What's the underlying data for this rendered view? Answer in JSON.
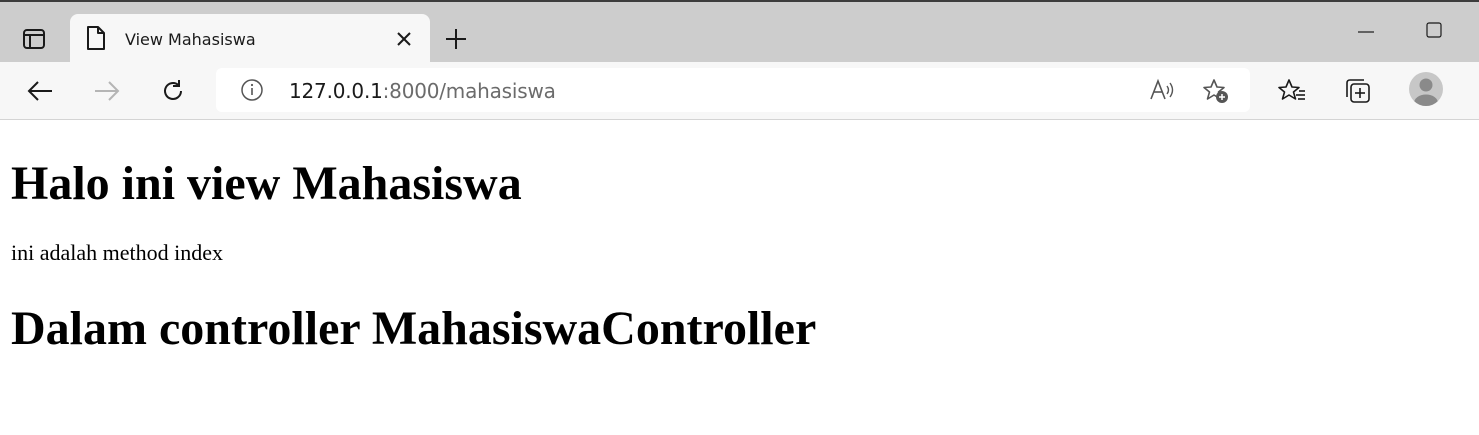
{
  "browser": {
    "tab": {
      "title": "View Mahasiswa"
    },
    "address": {
      "host": "127.0.0.1",
      "rest": ":8000/mahasiswa"
    },
    "icons": [
      "tab-actions-icon",
      "page-icon",
      "close-icon",
      "plus-icon",
      "minimize-icon",
      "maximize-icon",
      "back-arrow-icon",
      "forward-arrow-icon",
      "refresh-icon",
      "info-icon",
      "read-aloud-icon",
      "add-favorite-icon",
      "favorites-icon",
      "collections-icon",
      "profile-avatar"
    ]
  },
  "page": {
    "heading1": "Halo ini view Mahasiswa",
    "paragraph": "ini adalah method index",
    "heading2": "Dalam controller MahasiswaController"
  }
}
